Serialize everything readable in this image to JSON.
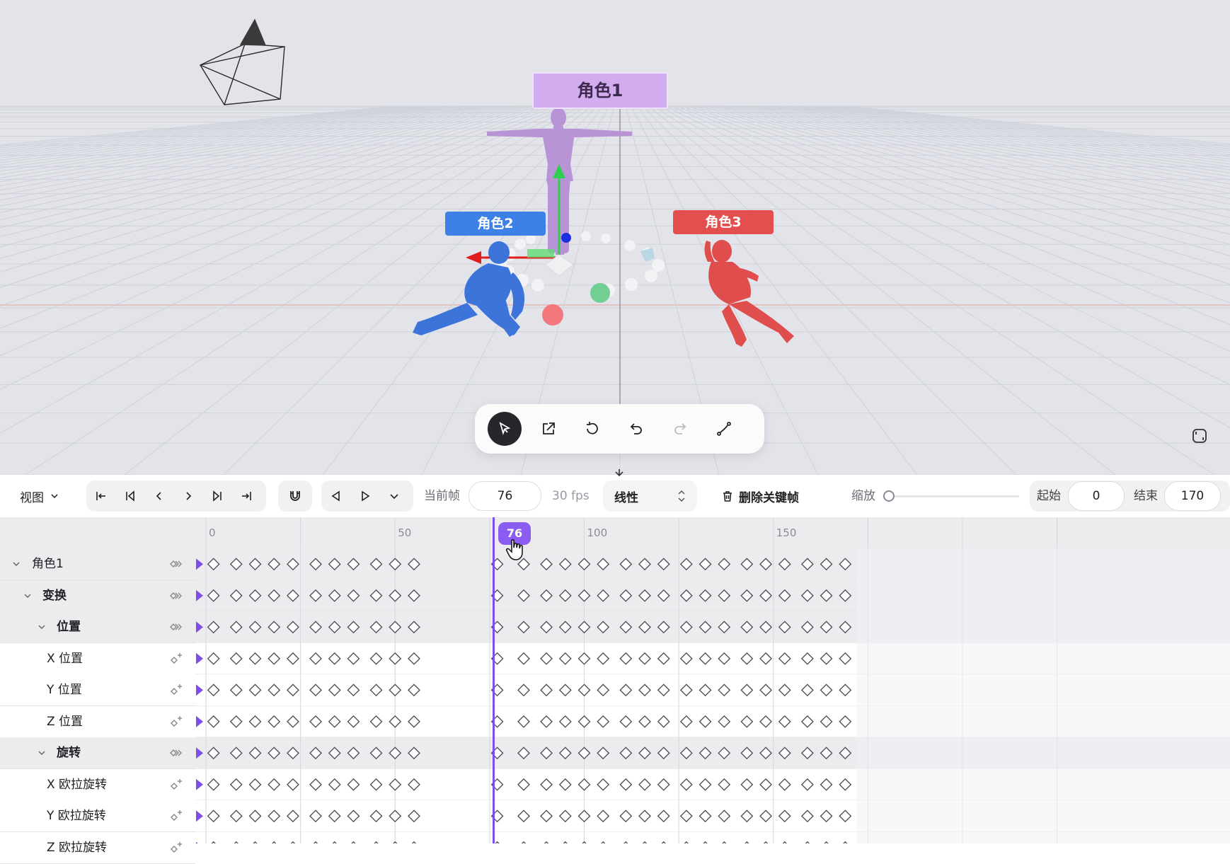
{
  "viewport": {
    "characters": [
      {
        "label": "角色1",
        "color": "#b894d6",
        "label_color": "#d3acf0"
      },
      {
        "label": "角色2",
        "color": "#3c74d9",
        "label_color": "#3d81e6"
      },
      {
        "label": "角色3",
        "color": "#e04d4d",
        "label_color": "#e34f4f"
      }
    ],
    "tools": [
      {
        "id": "select",
        "icon": "cursor-arrow-icon",
        "active": true
      },
      {
        "id": "move",
        "icon": "external-move-icon",
        "active": false
      },
      {
        "id": "rotate",
        "icon": "rotate-icon",
        "active": false
      },
      {
        "id": "undo",
        "icon": "undo-icon",
        "active": false
      },
      {
        "id": "redo",
        "icon": "redo-icon",
        "active": false,
        "disabled": true
      },
      {
        "id": "path",
        "icon": "bezier-path-icon",
        "active": false
      }
    ]
  },
  "toolbar": {
    "view_label": "视图",
    "current_frame_label": "当前帧",
    "current_frame": "76",
    "fps_label": "30 fps",
    "interpolation": "线性",
    "delete_keyframe_label": "删除关键帧",
    "zoom_label": "缩放",
    "zoom_level": 0,
    "start_label": "起始",
    "start_value": "0",
    "end_label": "结束",
    "end_value": "170"
  },
  "timeline": {
    "ruler_labels": [
      "0",
      "50",
      "100",
      "150"
    ],
    "playhead_frame": 76,
    "playhead_label": "76",
    "keyframes": [
      2,
      8,
      13,
      18,
      23,
      29,
      34,
      39,
      45,
      50,
      55,
      77,
      84,
      90,
      95,
      100,
      105,
      111,
      116,
      121,
      127,
      132,
      137,
      143,
      148,
      153,
      159,
      164,
      169
    ],
    "accent": "#7d4fe8",
    "tracks": [
      {
        "name": "角色1",
        "level": 0,
        "group": true,
        "bold": false
      },
      {
        "name": "变换",
        "level": 1,
        "group": true,
        "bold": true
      },
      {
        "name": "位置",
        "level": 2,
        "group": true,
        "bold": true
      },
      {
        "name": "X 位置",
        "level": 3,
        "group": false,
        "bold": false
      },
      {
        "name": "Y 位置",
        "level": 3,
        "group": false,
        "bold": false
      },
      {
        "name": "Z 位置",
        "level": 3,
        "group": false,
        "bold": false
      },
      {
        "name": "旋转",
        "level": 2,
        "group": true,
        "bold": true
      },
      {
        "name": "X 欧拉旋转",
        "level": 3,
        "group": false,
        "bold": false
      },
      {
        "name": "Y 欧拉旋转",
        "level": 3,
        "group": false,
        "bold": false
      },
      {
        "name": "Z 欧拉旋转",
        "level": 3,
        "group": false,
        "bold": false
      }
    ]
  }
}
